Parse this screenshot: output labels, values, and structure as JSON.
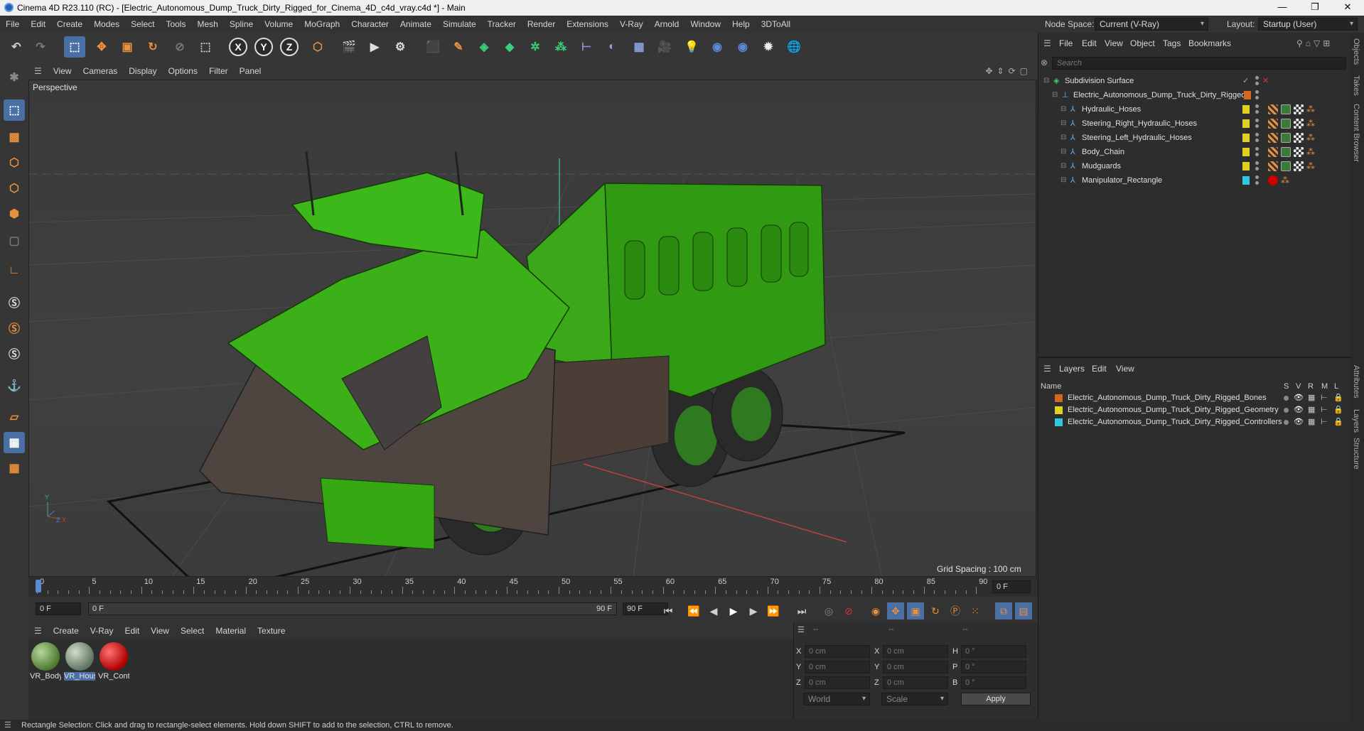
{
  "window": {
    "title": "Cinema 4D R23.110 (RC) - [Electric_Autonomous_Dump_Truck_Dirty_Rigged_for_Cinema_4D_c4d_vray.c4d *] - Main",
    "minimize": "—",
    "maximize": "❐",
    "close": "✕"
  },
  "menubar": [
    "File",
    "Edit",
    "Create",
    "Modes",
    "Select",
    "Tools",
    "Mesh",
    "Spline",
    "Volume",
    "MoGraph",
    "Character",
    "Animate",
    "Simulate",
    "Tracker",
    "Render",
    "Extensions",
    "V-Ray",
    "Arnold",
    "Window",
    "Help",
    "3DToAll"
  ],
  "node_space": {
    "label": "Node Space:",
    "value": "Current (V-Ray)"
  },
  "layout": {
    "label": "Layout:",
    "value": "Startup (User)"
  },
  "toolbar": {
    "axis_x": "X",
    "axis_y": "Y",
    "axis_z": "Z"
  },
  "viewport": {
    "menu": [
      "View",
      "Cameras",
      "Display",
      "Options",
      "Filter",
      "Panel"
    ],
    "label": "Perspective",
    "grid_spacing": "Grid Spacing : 100 cm"
  },
  "timeline": {
    "ticks": [
      "0",
      "5",
      "10",
      "15",
      "20",
      "25",
      "30",
      "35",
      "40",
      "45",
      "50",
      "55",
      "60",
      "65",
      "70",
      "75",
      "80",
      "85",
      "90"
    ],
    "frame_end_field": "0 F",
    "start_field": "0 F",
    "range_start": "0 F",
    "range_end": "90 F",
    "end_field": "90 F"
  },
  "materials": {
    "menu": [
      "Create",
      "V-Ray",
      "Edit",
      "View",
      "Select",
      "Material",
      "Texture"
    ],
    "items": [
      {
        "label": "VR_Body",
        "color": "#6c9a4a"
      },
      {
        "label": "VR_Hous",
        "color": "#8aa07a"
      },
      {
        "label": "VR_Cont",
        "color": "#cc1010"
      }
    ]
  },
  "coordinates": {
    "header": [
      "--",
      "--",
      "--"
    ],
    "rows": [
      {
        "a": "X",
        "av": "0 cm",
        "b": "X",
        "bv": "0 cm",
        "c": "H",
        "cv": "0 °"
      },
      {
        "a": "Y",
        "av": "0 cm",
        "b": "Y",
        "bv": "0 cm",
        "c": "P",
        "cv": "0 °"
      },
      {
        "a": "Z",
        "av": "0 cm",
        "b": "Z",
        "bv": "0 cm",
        "c": "B",
        "cv": "0 °"
      }
    ],
    "mode": "World",
    "scale": "Scale",
    "apply": "Apply"
  },
  "status": "Rectangle Selection: Click and drag to rectangle-select elements. Hold down SHIFT to add to the selection, CTRL to remove.",
  "objects": {
    "menu": [
      "File",
      "Edit",
      "View",
      "Object",
      "Tags",
      "Bookmarks"
    ],
    "search_placeholder": "Search",
    "rows": [
      {
        "name": "Subdivision Surface",
        "indent": 0,
        "layer": ""
      },
      {
        "name": "Electric_Autonomous_Dump_Truck_Dirty_Rigged",
        "indent": 1,
        "layer": "#d2691e"
      },
      {
        "name": "Hydraulic_Hoses",
        "indent": 2,
        "layer": "#e0d020"
      },
      {
        "name": "Steering_Right_Hydraulic_Hoses",
        "indent": 2,
        "layer": "#e0d020"
      },
      {
        "name": "Steering_Left_Hydraulic_Hoses",
        "indent": 2,
        "layer": "#e0d020"
      },
      {
        "name": "Body_Chain",
        "indent": 2,
        "layer": "#e0d020"
      },
      {
        "name": "Mudguards",
        "indent": 2,
        "layer": "#e0d020"
      },
      {
        "name": "Manipulator_Rectangle",
        "indent": 2,
        "layer": "#30c8e0"
      }
    ]
  },
  "layers": {
    "menu": [
      "Layers",
      "Edit",
      "View"
    ],
    "header": {
      "name": "Name",
      "cols": [
        "S",
        "V",
        "R",
        "M",
        "L"
      ]
    },
    "rows": [
      {
        "name": "Electric_Autonomous_Dump_Truck_Dirty_Rigged_Bones",
        "color": "#d2691e"
      },
      {
        "name": "Electric_Autonomous_Dump_Truck_Dirty_Rigged_Geometry",
        "color": "#e0d020"
      },
      {
        "name": "Electric_Autonomous_Dump_Truck_Dirty_Rigged_Controllers",
        "color": "#30c8e0"
      }
    ]
  },
  "side_tabs": [
    "Objects",
    "Takes",
    "Content Browser",
    "Attributes",
    "Layers",
    "Structure"
  ]
}
